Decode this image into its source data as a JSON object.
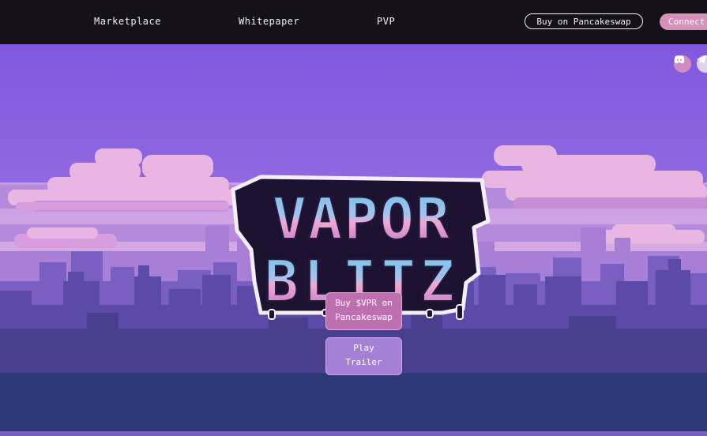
{
  "nav": {
    "links": [
      "Marketplace",
      "Whitepaper",
      "PVP"
    ],
    "buy_label": "Buy on Pancakeswap",
    "connect_label": "Connect"
  },
  "social": {
    "icons": [
      "discord-icon",
      "telegram-icon"
    ]
  },
  "logo": {
    "line1": "VAPOR",
    "line2": "BLITZ"
  },
  "cta": {
    "buy_line1": "Buy $VPR on",
    "buy_line2": "Pancakeswap",
    "play_line1": "Play",
    "play_line2": "Trailer"
  },
  "colors": {
    "nav_bg": "#141118",
    "sky": "#8a63e0",
    "accent_pink": "#d690b9",
    "city_dark": "#4a3e8e",
    "ground": "#2e3a78"
  }
}
